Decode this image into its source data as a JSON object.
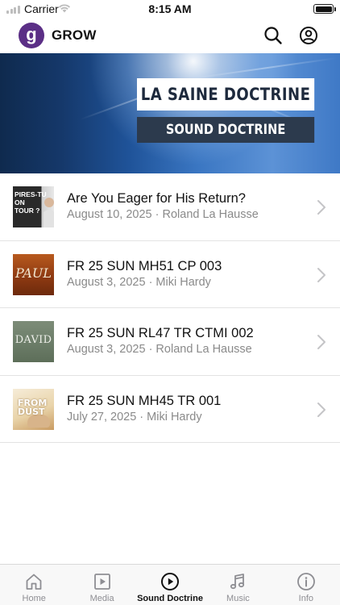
{
  "status_bar": {
    "carrier": "Carrier",
    "time": "8:15 AM",
    "icons": [
      "signal-icon",
      "wifi-icon",
      "battery-icon"
    ]
  },
  "header": {
    "logo_letter": "g",
    "title": "GROW",
    "logo_color": "#5b2f86",
    "icons": [
      "search-icon",
      "profile-icon"
    ]
  },
  "banner": {
    "title": "LA SAINE DOCTRINE",
    "subtitle": "SOUND DOCTRINE"
  },
  "items": [
    {
      "title": "Are You Eager for His Return?",
      "meta": "August 10, 2025 · Roland La Hausse",
      "thumb_text": "PIRES-TU\nON\nTOUR ?"
    },
    {
      "title": "FR 25 SUN MH51 CP 003",
      "meta": "August 3, 2025 · Miki Hardy",
      "thumb_text": "PAUL"
    },
    {
      "title": "FR 25 SUN RL47 TR CTMI 002",
      "meta": "August 3, 2025 · Roland La Hausse",
      "thumb_text": "DAVID"
    },
    {
      "title": "FR 25 SUN MH45 TR 001",
      "meta": "July 27, 2025 · Miki Hardy",
      "thumb_text": "FROM\nDUST"
    }
  ],
  "tabs": [
    {
      "label": "Home",
      "icon": "home-icon",
      "active": false
    },
    {
      "label": "Media",
      "icon": "media-icon",
      "active": false
    },
    {
      "label": "Sound Doctrine",
      "icon": "play-circle-icon",
      "active": true
    },
    {
      "label": "Music",
      "icon": "music-icon",
      "active": false
    },
    {
      "label": "Info",
      "icon": "info-icon",
      "active": false
    }
  ]
}
